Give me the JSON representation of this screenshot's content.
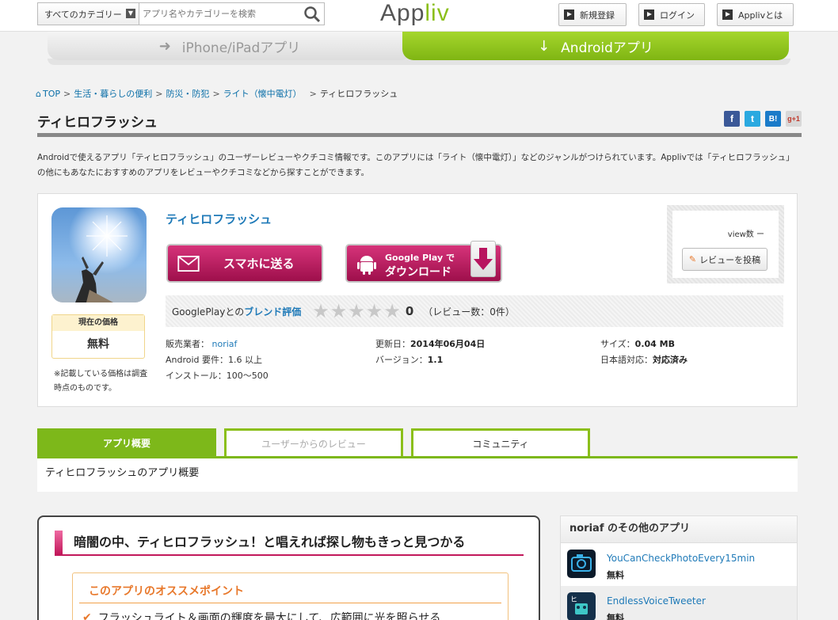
{
  "header": {
    "category_select": "すべてのカテゴリー",
    "search_placeholder": "アプリ名やカテゴリーを検索",
    "logo_main": "App",
    "logo_accent": "liv",
    "register_label": "新規登録",
    "login_label": "ログイン",
    "about_label": "Applivとは"
  },
  "platform_tabs": {
    "iphone": "iPhone/iPadアプリ",
    "android": "Androidアプリ"
  },
  "breadcrumb": {
    "top": "TOP",
    "c1": "生活・暮らしの便利",
    "c2": "防災・防犯",
    "c3": "ライト（懐中電灯）",
    "current": "ティヒロフラッシュ",
    "sep": ">"
  },
  "page_title": "ティヒロフラッシュ",
  "share": {
    "facebook": "f",
    "twitter": "t",
    "hatena": "B!",
    "gplus": "g+1"
  },
  "description": "Androidで使えるアプリ「ティヒロフラッシュ」のユーザーレビューやクチコミ情報です。このアプリには「ライト（懐中電灯）」などのジャンルがつけられています。Applivでは「ティヒロフラッシュ」の他にもあなたにおすすめのアプリをレビューやクチコミなどから探すことができます。",
  "app": {
    "name": "ティヒロフラッシュ",
    "price_label": "現在の価格",
    "price": "無料",
    "price_note": "※記載している価格は調査時点のものです。",
    "send_button": "スマホに送る",
    "gp_line1": "Google Play で",
    "gp_line2": "ダウンロード",
    "rating_prefix": "GooglePlayとの",
    "rating_link": "ブレンド評価",
    "score": "0",
    "review_count": "（レビュー数：0件）",
    "seller_label": "販売業者：",
    "seller": "noriaf",
    "android_req": "Android 要件：1.6 以上",
    "install": "インストール：100～500",
    "updated_label": "更新日：",
    "updated": "2014年06月04日",
    "version_label": "バージョン：",
    "version": "1.1",
    "size_label": "サイズ：",
    "size": "0.04 MB",
    "ja_label": "日本語対応：",
    "ja": "対応済み",
    "view_label": "view数 ー",
    "review_post": "レビューを投稿"
  },
  "content_tabs": {
    "overview": "アプリ概要",
    "reviews": "ユーザーからのレビュー",
    "community": "コミュニティ"
  },
  "overview_title": "ティヒロフラッシュのアプリ概要",
  "article": {
    "title": "暗闇の中、ティヒロフラッシュ！と唱えれば探し物もきっと見つかる",
    "osusume_title": "このアプリのオススメポイント",
    "point1": "フラッシュライト＆画面の輝度を最大にして、広範囲に光を照らせる"
  },
  "sidebar": {
    "title": "noriaf のその他のアプリ",
    "apps": [
      {
        "name": "YouCanCheckPhotoEvery15min",
        "price": "無料"
      },
      {
        "name": "EndlessVoiceTweeter",
        "price": "無料"
      }
    ]
  },
  "colors": {
    "accent_green": "#7db81a",
    "link_blue": "#1f7ab8",
    "button_magenta": "#b8145f"
  }
}
